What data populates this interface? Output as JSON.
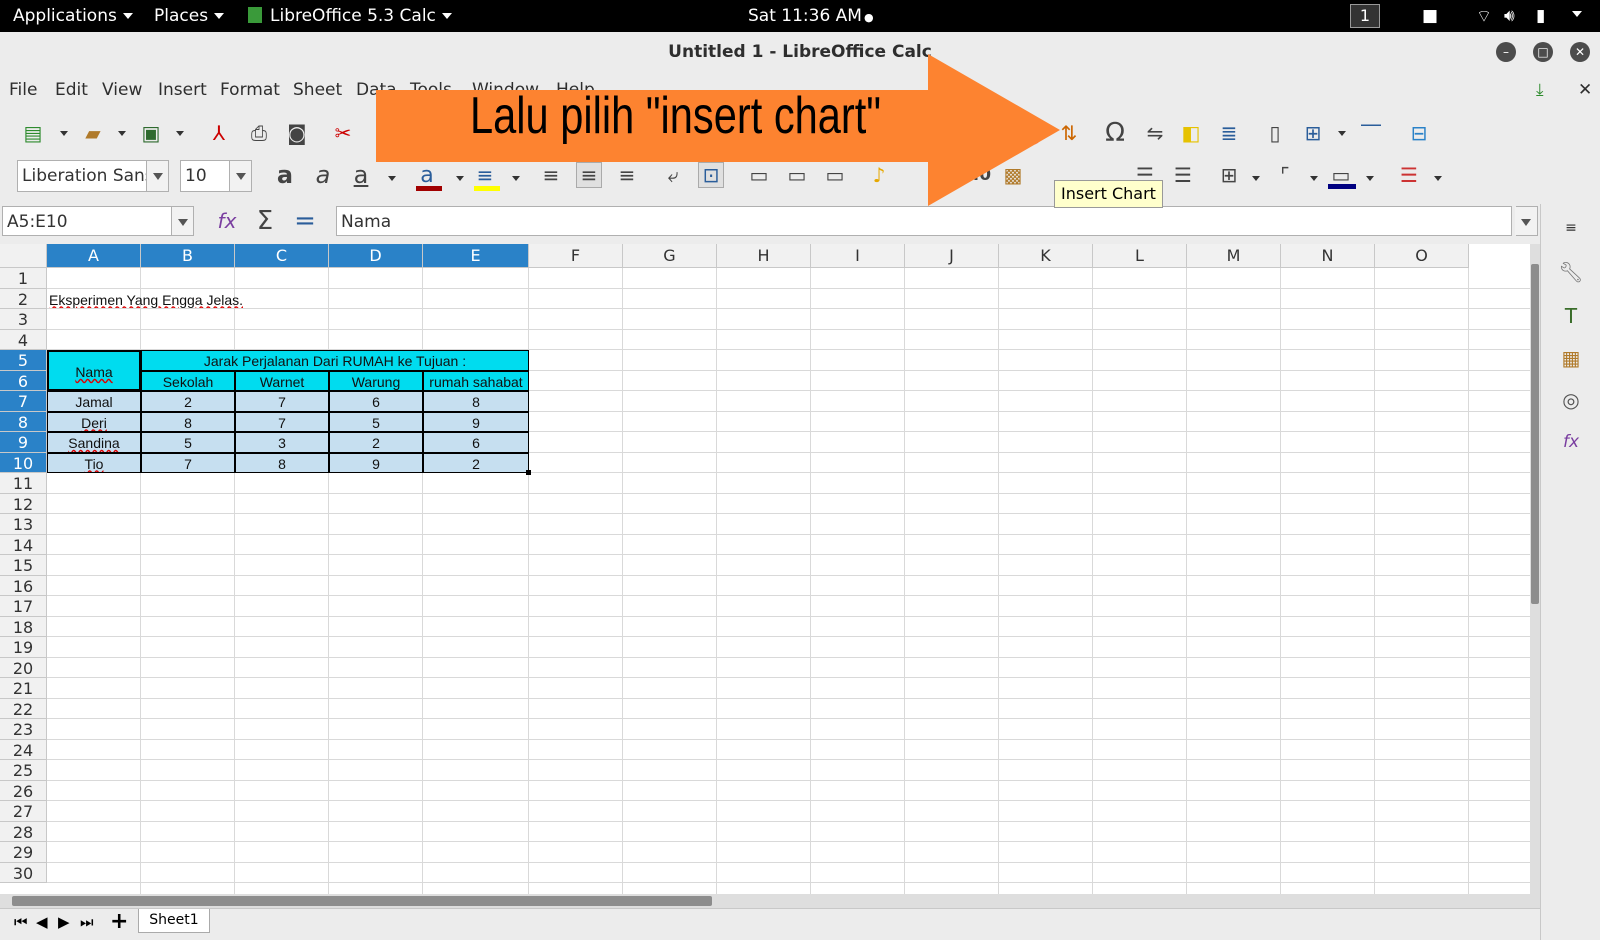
{
  "topbar": {
    "applications": "Applications",
    "places": "Places",
    "app": "LibreOffice 5.3 Calc",
    "clock": "Sat 11:36 AM",
    "clock_dot": "●",
    "workspace": "1"
  },
  "window": {
    "title": "Untitled 1 - LibreOffice Calc"
  },
  "menu": [
    "File",
    "Edit",
    "View",
    "Insert",
    "Format",
    "Sheet",
    "Data",
    "Tools",
    "Window",
    "Help"
  ],
  "toolbar": {
    "font_name": "Liberation Sans",
    "font_size": "10",
    "number_format": "0.0",
    "tooltip": "Insert Chart",
    "font_color": "#a10000",
    "highlight_color": "#ffff00",
    "border_color": "#000080"
  },
  "formula": {
    "name_box": "A5:E10",
    "content": "Nama",
    "sum": "Σ",
    "equals": "="
  },
  "annotation": {
    "text": "Lalu pilih \"insert chart\"",
    "color": "#fd8330"
  },
  "sheet": {
    "columns": [
      "A",
      "B",
      "C",
      "D",
      "E",
      "F",
      "G",
      "H",
      "I",
      "J",
      "K",
      "L",
      "M",
      "N",
      "O"
    ],
    "rows": [
      "1",
      "2",
      "3",
      "4",
      "5",
      "6",
      "7",
      "8",
      "9",
      "10",
      "11",
      "12",
      "13",
      "14",
      "15",
      "16",
      "17",
      "18",
      "19",
      "20",
      "21",
      "22",
      "23",
      "24",
      "25",
      "26",
      "27",
      "28",
      "29",
      "30"
    ],
    "title_cell": "Eksperimen Yang Engga Jelas.",
    "table": {
      "header_nama": "Nama",
      "header_group": "Jarak Perjalanan Dari RUMAH ke Tujuan :",
      "sub_headers": [
        "Sekolah",
        "Warnet",
        "Warung",
        "rumah sahabat"
      ],
      "rows": [
        {
          "name": "Jamal",
          "values": [
            "2",
            "7",
            "6",
            "8"
          ]
        },
        {
          "name": "Deri",
          "values": [
            "8",
            "7",
            "5",
            "9"
          ]
        },
        {
          "name": "Sandina",
          "values": [
            "5",
            "3",
            "2",
            "6"
          ]
        },
        {
          "name": "Tio",
          "values": [
            "7",
            "8",
            "9",
            "2"
          ]
        }
      ],
      "header_color": "#00dcef",
      "body_color": "#c6dff0"
    },
    "tab": "Sheet1"
  }
}
